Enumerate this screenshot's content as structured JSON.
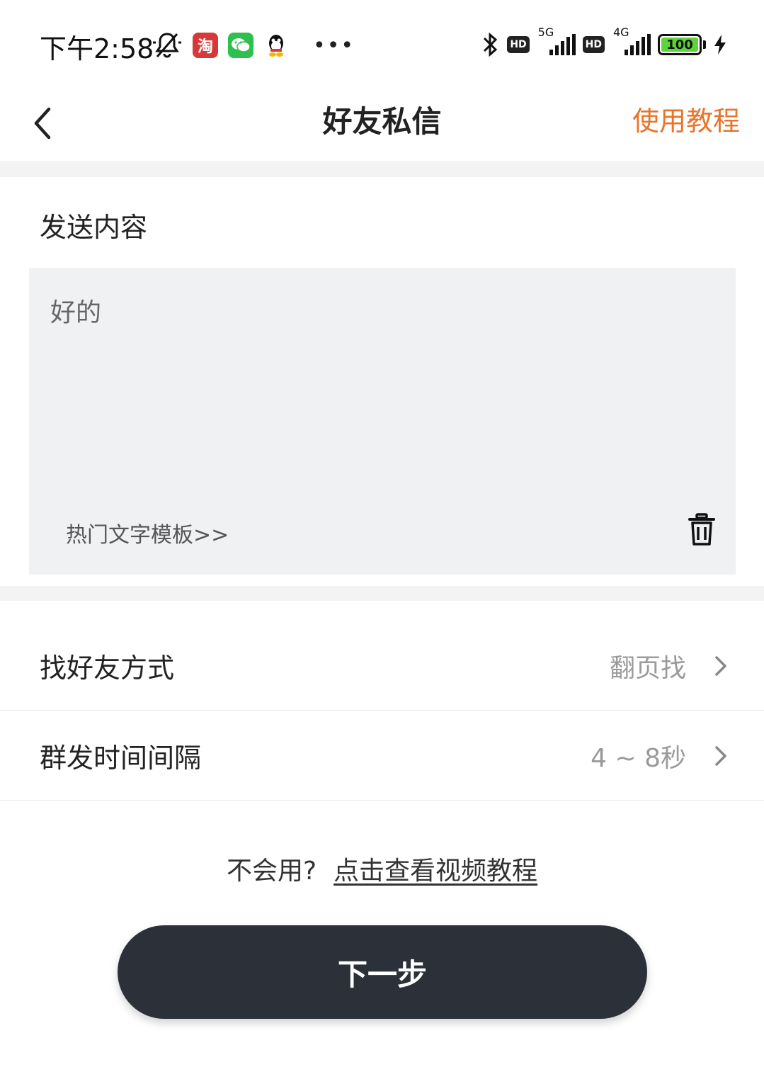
{
  "status_bar": {
    "time": "下午2:58",
    "taobao_badge": "淘",
    "more_dots": "•••",
    "hd_label": "HD",
    "net1_label": "5G",
    "net2_label": "4G",
    "battery": "100"
  },
  "nav": {
    "title": "好友私信",
    "action": "使用教程"
  },
  "content": {
    "section_title": "发送内容",
    "message_text": "好的",
    "template_link": "热门文字模板>>"
  },
  "settings": [
    {
      "label": "找好友方式",
      "value": "翻页找"
    },
    {
      "label": "群发时间间隔",
      "value": "4 ~ 8秒"
    }
  ],
  "help": {
    "prompt": "不会用?",
    "link": "点击查看视频教程"
  },
  "next_button": "下一步",
  "colors": {
    "accent": "#e8742a",
    "button_bg": "#2b3039",
    "editor_bg": "#f0f1f2"
  }
}
